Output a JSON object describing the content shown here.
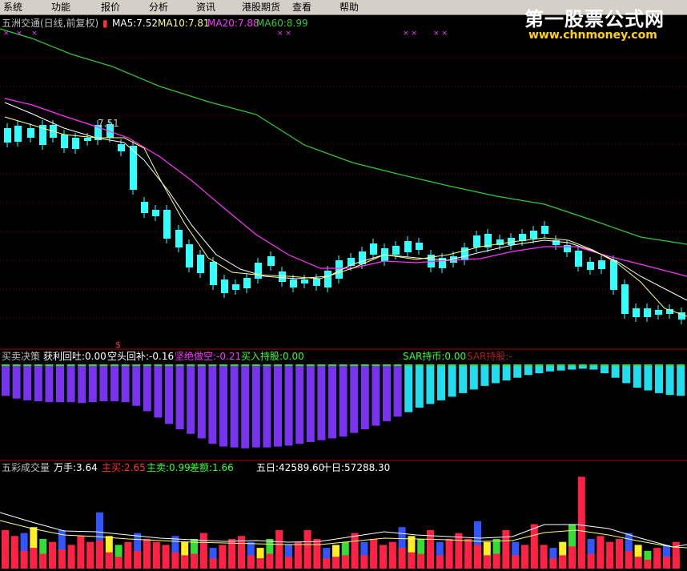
{
  "menu": [
    "系统",
    "功能",
    "报价",
    "分析",
    "资讯",
    "港股期货",
    "查看",
    "帮助"
  ],
  "watermark": {
    "cn": "第一股票公式网",
    "url": "www.chnmoney.com"
  },
  "main_panel": {
    "title": "五洲交通(日线,前复权)",
    "ma5": "MA5:7.52",
    "ma10": "MA10:7.81",
    "ma20": "MA20:7.88",
    "ma60": "MA60:8.99",
    "high_mark": "7.51",
    "dollar_mark": "$",
    "colors": {
      "ma5": "#ffffff",
      "ma10": "#ffff80",
      "ma20": "#ff33ff",
      "ma60": "#33cc33",
      "up": "#33ffff",
      "down": "#33ffff"
    }
  },
  "indicator_panel": {
    "name": "买卖决策",
    "profit": "获利回吐:0.00",
    "short_cover": "空头回补:-0.16",
    "firm_short": "坚绝做空:-0.21",
    "buy_hold": "买入持股:0.00",
    "sar_coin": "SAR持币:0.00",
    "sar_hold": "SAR持股:-",
    "values": [
      -0.33,
      -0.36,
      -0.38,
      -0.39,
      -0.4,
      -0.4,
      -0.4,
      -0.41,
      -0.4,
      -0.39,
      -0.39,
      -0.4,
      -0.44,
      -0.5,
      -0.57,
      -0.64,
      -0.7,
      -0.75,
      -0.8,
      -0.86,
      -0.89,
      -0.9,
      -0.91,
      -0.9,
      -0.9,
      -0.89,
      -0.88,
      -0.86,
      -0.84,
      -0.82,
      -0.8,
      -0.78,
      -0.74,
      -0.7,
      -0.66,
      -0.61,
      -0.56,
      -0.51,
      -0.46,
      -0.42,
      -0.38,
      -0.34,
      -0.3,
      -0.26,
      -0.22,
      -0.19,
      -0.16,
      -0.13,
      -0.1,
      -0.08,
      -0.06,
      -0.05,
      -0.04,
      -0.03,
      -0.04,
      -0.08,
      -0.13,
      -0.19,
      -0.24,
      -0.27,
      -0.3,
      -0.32,
      -0.33
    ]
  },
  "volume_panel": {
    "name": "五彩成交量",
    "unit": "万手:3.64",
    "main_buy": "主买:2.65",
    "main_sell": "主卖:0.99",
    "diff": "差额:1.66",
    "five_day": "五日:42589.60",
    "ten_day": "十日:57288.30",
    "values": [
      1.3,
      1.1,
      1.2,
      1.4,
      1.0,
      0.9,
      1.3,
      0.8,
      1.1,
      0.9,
      1.9,
      1.1,
      0.8,
      0.9,
      1.2,
      1.0,
      0.9,
      0.8,
      1.1,
      0.9,
      1.0,
      1.2,
      0.7,
      0.8,
      1.0,
      1.1,
      0.9,
      0.7,
      1.0,
      1.3,
      0.8,
      0.9,
      1.3,
      1.0,
      0.7,
      0.8,
      0.9,
      1.2,
      0.9,
      1.0,
      0.8,
      0.9,
      1.4,
      1.1,
      1.0,
      1.3,
      0.9,
      1.0,
      1.2,
      1.0,
      1.6,
      0.9,
      1.0,
      1.3,
      0.9,
      0.8,
      1.5,
      0.8,
      0.7,
      0.9,
      1.5,
      3.1,
      1.0,
      1.1,
      0.9,
      1.0,
      1.2,
      0.8,
      0.6,
      0.7,
      0.8,
      0.9
    ]
  }
}
